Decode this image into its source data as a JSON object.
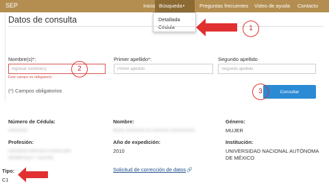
{
  "navbar": {
    "brand": "SEP",
    "items": [
      {
        "label": "Inicio",
        "has_caret": true
      },
      {
        "label": "Búsqueda",
        "has_caret": true,
        "active": true
      },
      {
        "label": "Preguntas frecuentes"
      },
      {
        "label": "Video de ayuda"
      },
      {
        "label": "Contacto"
      }
    ],
    "caret_icon": "▾",
    "background": "#b38e50",
    "active_background": "#8c6a34"
  },
  "search_dropdown": {
    "items": [
      "Detallada",
      "Cédula"
    ]
  },
  "page": {
    "title": "Datos de consulta"
  },
  "form": {
    "fields": [
      {
        "label": "Nombre(s)*:",
        "placeholder": "Ingresar nombre(s)",
        "value": ""
      },
      {
        "label": "Primer apellido*:",
        "placeholder": "Primer apellido",
        "value": ""
      },
      {
        "label": "Segundo apellido",
        "placeholder": "Segundo apellido",
        "value": ""
      }
    ],
    "error_message": "Este campo es obligatorio.",
    "required_note": "(*) Campos obligatorios",
    "submit_label": "Consultar",
    "accent_color": "#2a8ad4",
    "error_color": "#d9534f"
  },
  "results": {
    "numero_cedula": {
      "label": "Número de Cédula:",
      "value": "XXXXXXX"
    },
    "nombre": {
      "label": "Nombre:",
      "value": "NUXX XXXXXXX XX XXXXXX XXXXXXXXX"
    },
    "genero": {
      "label": "Género:",
      "value": "MUJER"
    },
    "profesion": {
      "label": "Profesión:",
      "value_lines": [
        "LICENCIATURA EN LITERATURA",
        "DRAMATICA Y TEATRO"
      ]
    },
    "anio_expedicion": {
      "label": "Año de expedición:",
      "value": "2010"
    },
    "institucion": {
      "label": "Institución:",
      "value_lines": [
        "UNIVERSIDAD NACIONAL AUTÓNOMA",
        "DE MÉXICO"
      ]
    },
    "tipo": {
      "label": "Tipo:",
      "value": "C1"
    },
    "correction_link": "Solicitud de corrección de datos"
  },
  "annotations": {
    "markers": [
      "1",
      "2",
      "3"
    ],
    "color": "#e03030"
  }
}
